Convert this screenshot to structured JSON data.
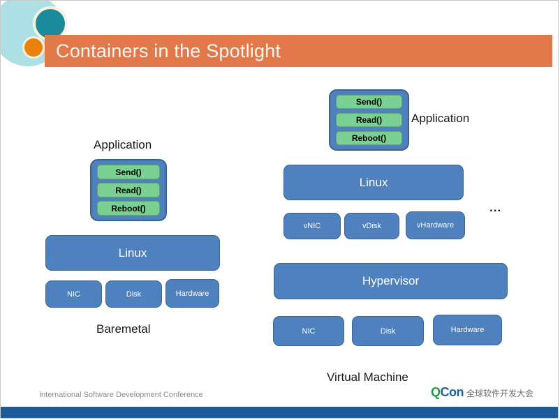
{
  "slide": {
    "title": "Containers in the Spotlight",
    "colors": {
      "title_bar": "#E1794B",
      "title_text": "#FDF6F0",
      "box_blue": "#4E81BD",
      "box_blue_border": "#3C6498",
      "box_green": "#7ACF92",
      "box_green_border": "#5FA875",
      "footer_bar": "#1C5A9C",
      "deco_cyan": "#ADE0E4",
      "deco_teal": "#1B8A9B",
      "deco_orange": "#E8820C"
    }
  },
  "decorations": {
    "circle_large": "large-cyan-circle",
    "circle_teal": "teal-circle",
    "circle_orange": "orange-circle"
  },
  "baremetal_diagram": {
    "app_label": "Application",
    "app_calls": [
      "Send()",
      "Read()",
      "Reboot()"
    ],
    "os_label": "Linux",
    "hardware_boxes": [
      "NIC",
      "Disk",
      "Hardware"
    ],
    "caption": "Baremetal"
  },
  "vm_diagram": {
    "app_label": "Application",
    "app_calls": [
      "Send()",
      "Read()",
      "Reboot()"
    ],
    "os_label": "Linux",
    "virtual_boxes": [
      "vNIC",
      "vDisk",
      "vHardware"
    ],
    "ellipsis": "...",
    "hypervisor_label": "Hypervisor",
    "hardware_boxes": [
      "NIC",
      "Disk",
      "Hardware"
    ],
    "caption": "Virtual Machine"
  },
  "footer": {
    "conference_text": "International Software Development Conference",
    "logo_q": "Q",
    "logo_con": "Con",
    "logo_chinese": "全球软件开发大会"
  }
}
